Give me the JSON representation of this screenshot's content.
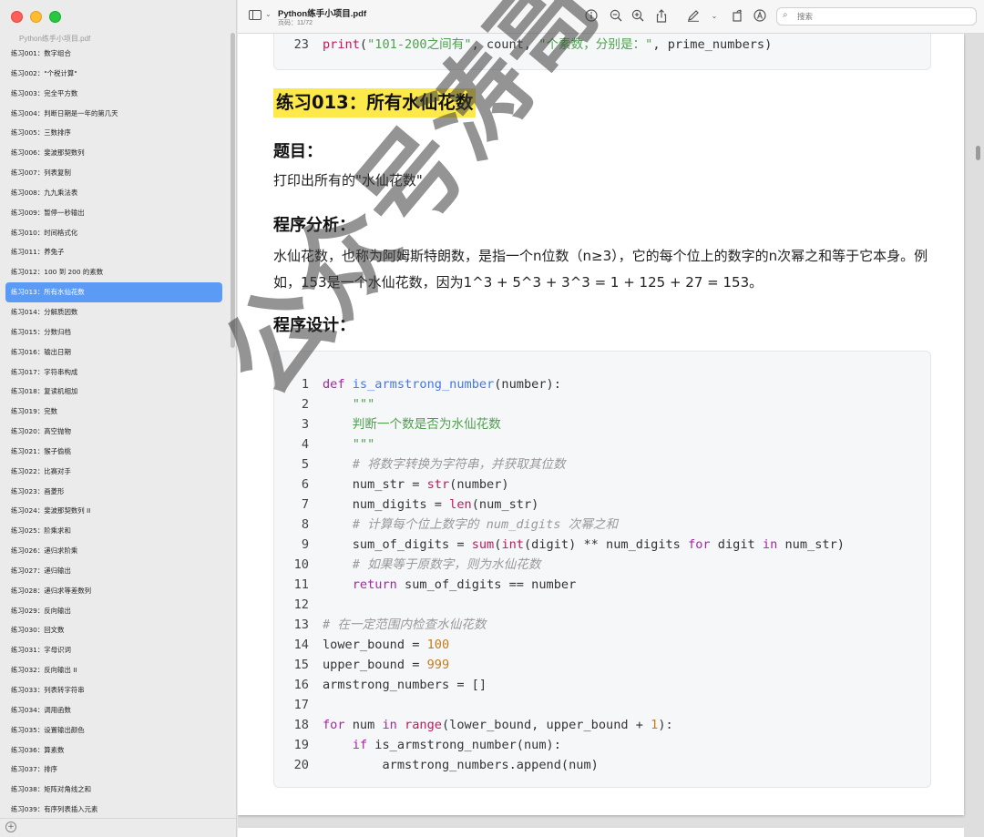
{
  "window": {
    "doc_title": "Python练手小项目.pdf",
    "page_label": "页码：11/72"
  },
  "sidebar": {
    "title": "Python练手小项目.pdf",
    "active_index": 12,
    "items": [
      "练习001：数字组合",
      "练习002：\"个税计算\"",
      "练习003：完全平方数",
      "练习004：判断日期是一年的第几天",
      "练习005：三数排序",
      "练习006：斐波那契数列",
      "练习007：列表复制",
      "练习008：九九乘法表",
      "练习009：暂停一秒输出",
      "练习010：时间格式化",
      "练习011：养兔子",
      "练习012：100 到 200 的素数",
      "练习013：所有水仙花数",
      "练习014：分解质因数",
      "练习015：分数归档",
      "练习016：输出日期",
      "练习017：字符串构成",
      "练习018：复读机相加",
      "练习019：完数",
      "练习020：高空抛物",
      "练习021：猴子偷桃",
      "练习022：比赛对手",
      "练习023：画菱形",
      "练习024：斐波那契数列 II",
      "练习025：阶乘求和",
      "练习026：递归求阶乘",
      "练习027：递归输出",
      "练习028：递归求等差数列",
      "练习029：反向输出",
      "练习030：回文数",
      "练习031：字母识词",
      "练习032：反向输出 II",
      "练习033：列表转字符串",
      "练习034：调用函数",
      "练习035：设置输出颜色",
      "练习036：算素数",
      "练习037：排序",
      "练习038：矩阵对角线之和",
      "练习039：有序列表插入元素"
    ]
  },
  "toolbar": {
    "search_placeholder": "搜索",
    "icons": [
      "sidebar-toggle-icon",
      "info-icon",
      "zoom-out-icon",
      "zoom-in-icon",
      "share-icon",
      "highlight-pen-icon",
      "rotate-icon",
      "markup-icon",
      "search-icon"
    ]
  },
  "document": {
    "top_code": {
      "num": "23",
      "fn": "print",
      "s1": "\"101-200之间有\"",
      "mid": ", count, ",
      "s2": "\"个素数，分别是：\"",
      "end": ", prime_numbers)"
    },
    "section_title": "练习013：所有水仙花数",
    "h_question": "题目：",
    "question_text": "打印出所有的\"水仙花数\"",
    "h_analysis": "程序分析：",
    "analysis_text": "水仙花数，也称为阿姆斯特朗数，是指一个n位数（n≥3），它的每个位上的数字的n次幂之和等于它本身。例如，153是一个水仙花数，因为1^3 + 5^3 + 3^3 = 1 + 125 + 27 = 153。",
    "h_design": "程序设计：",
    "code": {
      "l1": {
        "num": "1",
        "kw": "def",
        "sp": " ",
        "fn": "is_armstrong_number",
        "rest": "(number):"
      },
      "l2": {
        "num": "2",
        "text": "    \"\"\""
      },
      "l3": {
        "num": "3",
        "text": "    判断一个数是否为水仙花数"
      },
      "l4": {
        "num": "4",
        "text": "    \"\"\""
      },
      "l5": {
        "num": "5",
        "text": "    # 将数字转换为字符串，并获取其位数"
      },
      "l6": {
        "num": "6",
        "a": "    num_str = ",
        "bi": "str",
        "b": "(number)"
      },
      "l7": {
        "num": "7",
        "a": "    num_digits = ",
        "bi": "len",
        "b": "(num_str)"
      },
      "l8": {
        "num": "8",
        "text": "    # 计算每个位上数字的 num_digits 次幂之和"
      },
      "l9": {
        "num": "9",
        "a": "    sum_of_digits = ",
        "bi1": "sum",
        "p1": "(",
        "bi2": "int",
        "b": "(digit) ** num_digits ",
        "kw1": "for",
        "c": " digit ",
        "kw2": "in",
        "d": " num_str)"
      },
      "l10": {
        "num": "10",
        "text": "    # 如果等于原数字，则为水仙花数"
      },
      "l11": {
        "num": "11",
        "pre": "    ",
        "kw": "return",
        "rest": " sum_of_digits == number"
      },
      "l12": {
        "num": "12"
      },
      "l13": {
        "num": "13",
        "text": "# 在一定范围内检查水仙花数"
      },
      "l14": {
        "num": "14",
        "a": "lower_bound = ",
        "n": "100"
      },
      "l15": {
        "num": "15",
        "a": "upper_bound = ",
        "n": "999"
      },
      "l16": {
        "num": "16",
        "a": "armstrong_numbers = []"
      },
      "l17": {
        "num": "17"
      },
      "l18": {
        "num": "18",
        "kw1": "for",
        "a": " num ",
        "kw2": "in",
        "sp": " ",
        "bi": "range",
        "b": "(lower_bound, upper_bound + ",
        "n": "1",
        "c": "):"
      },
      "l19": {
        "num": "19",
        "pre": "    ",
        "kw": "if",
        "rest": " is_armstrong_number(num):"
      },
      "l20": {
        "num": "20",
        "text": "        armstrong_numbers.append(num)"
      }
    },
    "watermark": "公众号涛哥聊Python"
  }
}
